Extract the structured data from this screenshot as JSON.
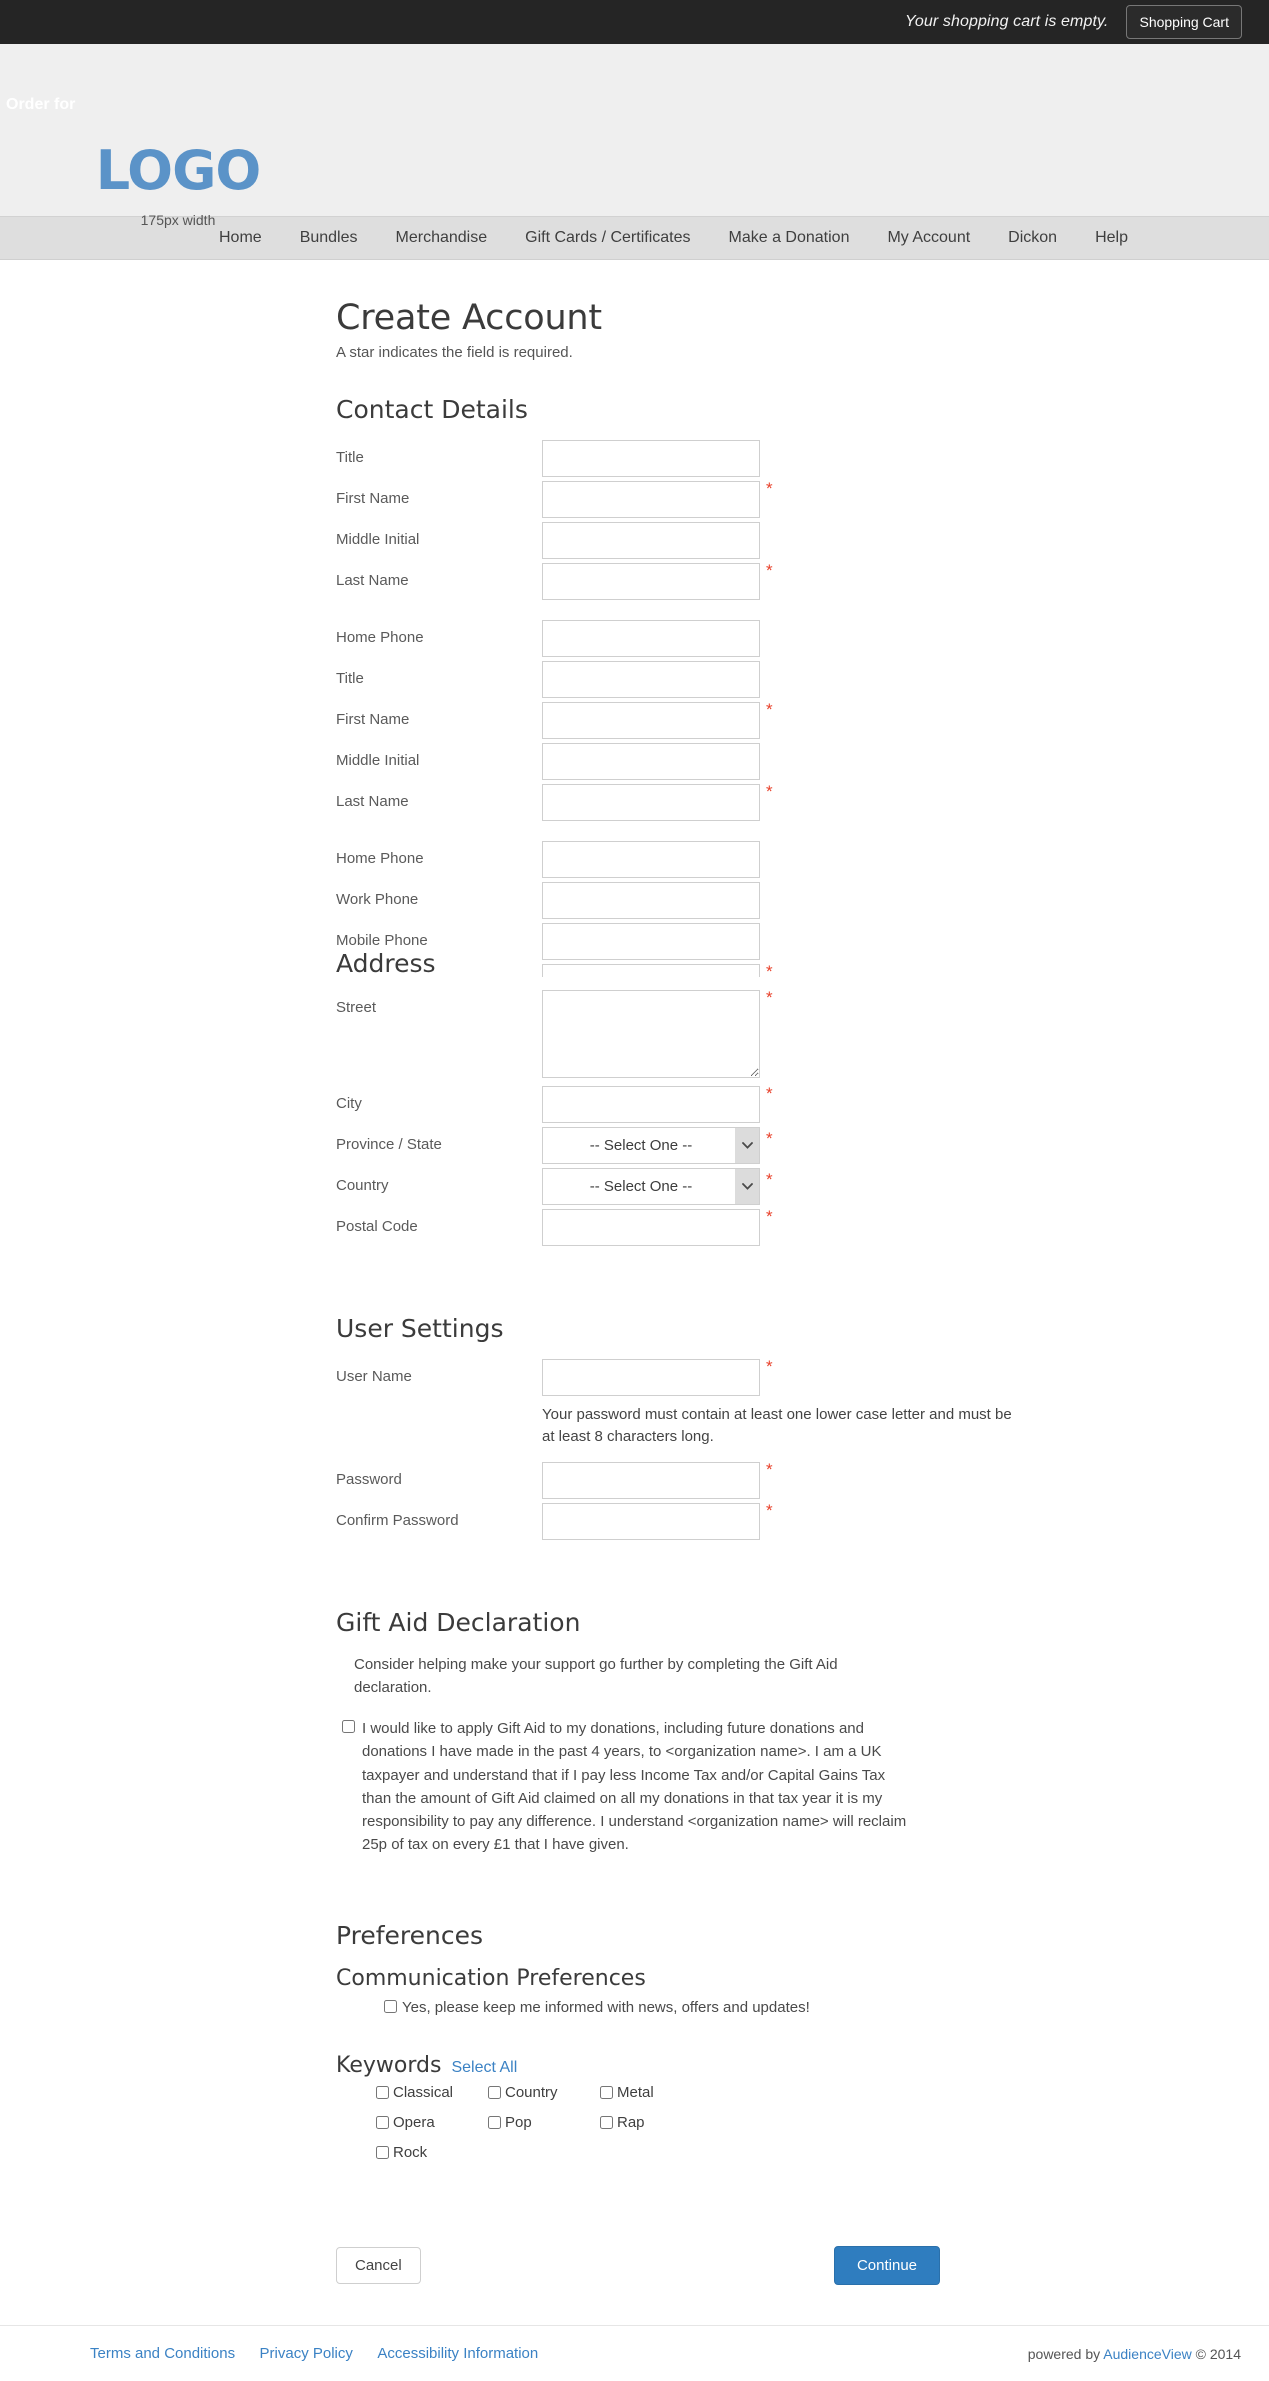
{
  "topbar": {
    "cart_message": "Your shopping cart is empty.",
    "cart_button": "Shopping Cart"
  },
  "masthead": {
    "order_for": "Order for",
    "logo_text": "LOGO",
    "logo_sub": "175px width",
    "logo_color": "#5b93c8"
  },
  "nav": {
    "items": [
      {
        "label": "Home"
      },
      {
        "label": "Bundles"
      },
      {
        "label": "Merchandise"
      },
      {
        "label": "Gift Cards / Certificates"
      },
      {
        "label": "Make a Donation"
      },
      {
        "label": "My Account"
      },
      {
        "label": "Dickon"
      },
      {
        "label": "Help"
      }
    ]
  },
  "page": {
    "title": "Create Account",
    "star_note": "A star indicates the field is required.",
    "required_marker": "*",
    "required_color": "#e8402a"
  },
  "contact_details": {
    "heading": "Contact Details",
    "fields_group_one": [
      {
        "label": "Title",
        "value": "",
        "required": false
      },
      {
        "label": "First Name",
        "value": "",
        "required": true
      },
      {
        "label": "Middle Initial",
        "value": "",
        "required": false
      },
      {
        "label": "Last Name",
        "value": "",
        "required": true
      },
      {
        "label": "Home Phone",
        "value": "",
        "required": false
      }
    ],
    "fields_group_two": [
      {
        "label": "Title",
        "value": "",
        "required": false
      },
      {
        "label": "First Name",
        "value": "",
        "required": true
      },
      {
        "label": "Middle Initial",
        "value": "",
        "required": false
      },
      {
        "label": "Last Name",
        "value": "",
        "required": true
      },
      {
        "label": "Home Phone",
        "value": "",
        "required": false
      },
      {
        "label": "Work Phone",
        "value": "",
        "required": false
      },
      {
        "label": "Mobile Phone",
        "value": "",
        "required": false
      }
    ]
  },
  "address": {
    "heading": "Address",
    "street_label": "Street",
    "street_value": "",
    "city_label": "City",
    "city_value": "",
    "province_label": "Province / State",
    "province_selected": "-- Select One --",
    "country_label": "Country",
    "country_selected": "-- Select One --",
    "postal_label": "Postal Code",
    "postal_value": "",
    "select_placeholder": "-- Select One --"
  },
  "user_settings": {
    "heading": "User Settings",
    "username_label": "User Name",
    "username_value": "",
    "password_hint": "Your password must contain at least one lower case letter and must be at least 8 characters long.",
    "password_label": "Password",
    "password_value": "",
    "confirm_label": "Confirm Password",
    "confirm_value": ""
  },
  "gift_aid": {
    "heading": "Gift Aid Declaration",
    "intro": "Consider helping make your support go further by completing the Gift Aid declaration.",
    "checkbox_text": "I would like to apply Gift Aid to my donations, including future donations and donations I have made in the past 4 years, to <organization name>. I am a UK taxpayer and understand that if I pay less Income Tax and/or Capital Gains Tax than the amount of Gift Aid claimed on all my donations in that tax year it is my responsibility to pay any difference. I understand <organization name> will reclaim 25p of tax on every £1 that I have given.",
    "checked": false
  },
  "preferences": {
    "heading": "Preferences",
    "communication": {
      "heading": "Communication Preferences",
      "checkbox_text": "Yes, please keep me informed with news, offers and updates!",
      "checked": false
    },
    "keywords": {
      "heading": "Keywords",
      "select_all_label": "Select All",
      "items": [
        {
          "label": "Classical",
          "checked": false
        },
        {
          "label": "Country",
          "checked": false
        },
        {
          "label": "Metal",
          "checked": false
        },
        {
          "label": "Opera",
          "checked": false
        },
        {
          "label": "Pop",
          "checked": false
        },
        {
          "label": "Rap",
          "checked": false
        },
        {
          "label": "Rock",
          "checked": false
        }
      ]
    }
  },
  "actions": {
    "cancel_label": "Cancel",
    "continue_label": "Continue",
    "continue_color": "#2f7dbf"
  },
  "footer": {
    "links": [
      {
        "label": "Terms and Conditions"
      },
      {
        "label": "Privacy Policy"
      },
      {
        "label": "Accessibility Information"
      }
    ],
    "powered_prefix": "powered by",
    "powered_brand": "AudienceView",
    "powered_suffix": "© 2014"
  }
}
